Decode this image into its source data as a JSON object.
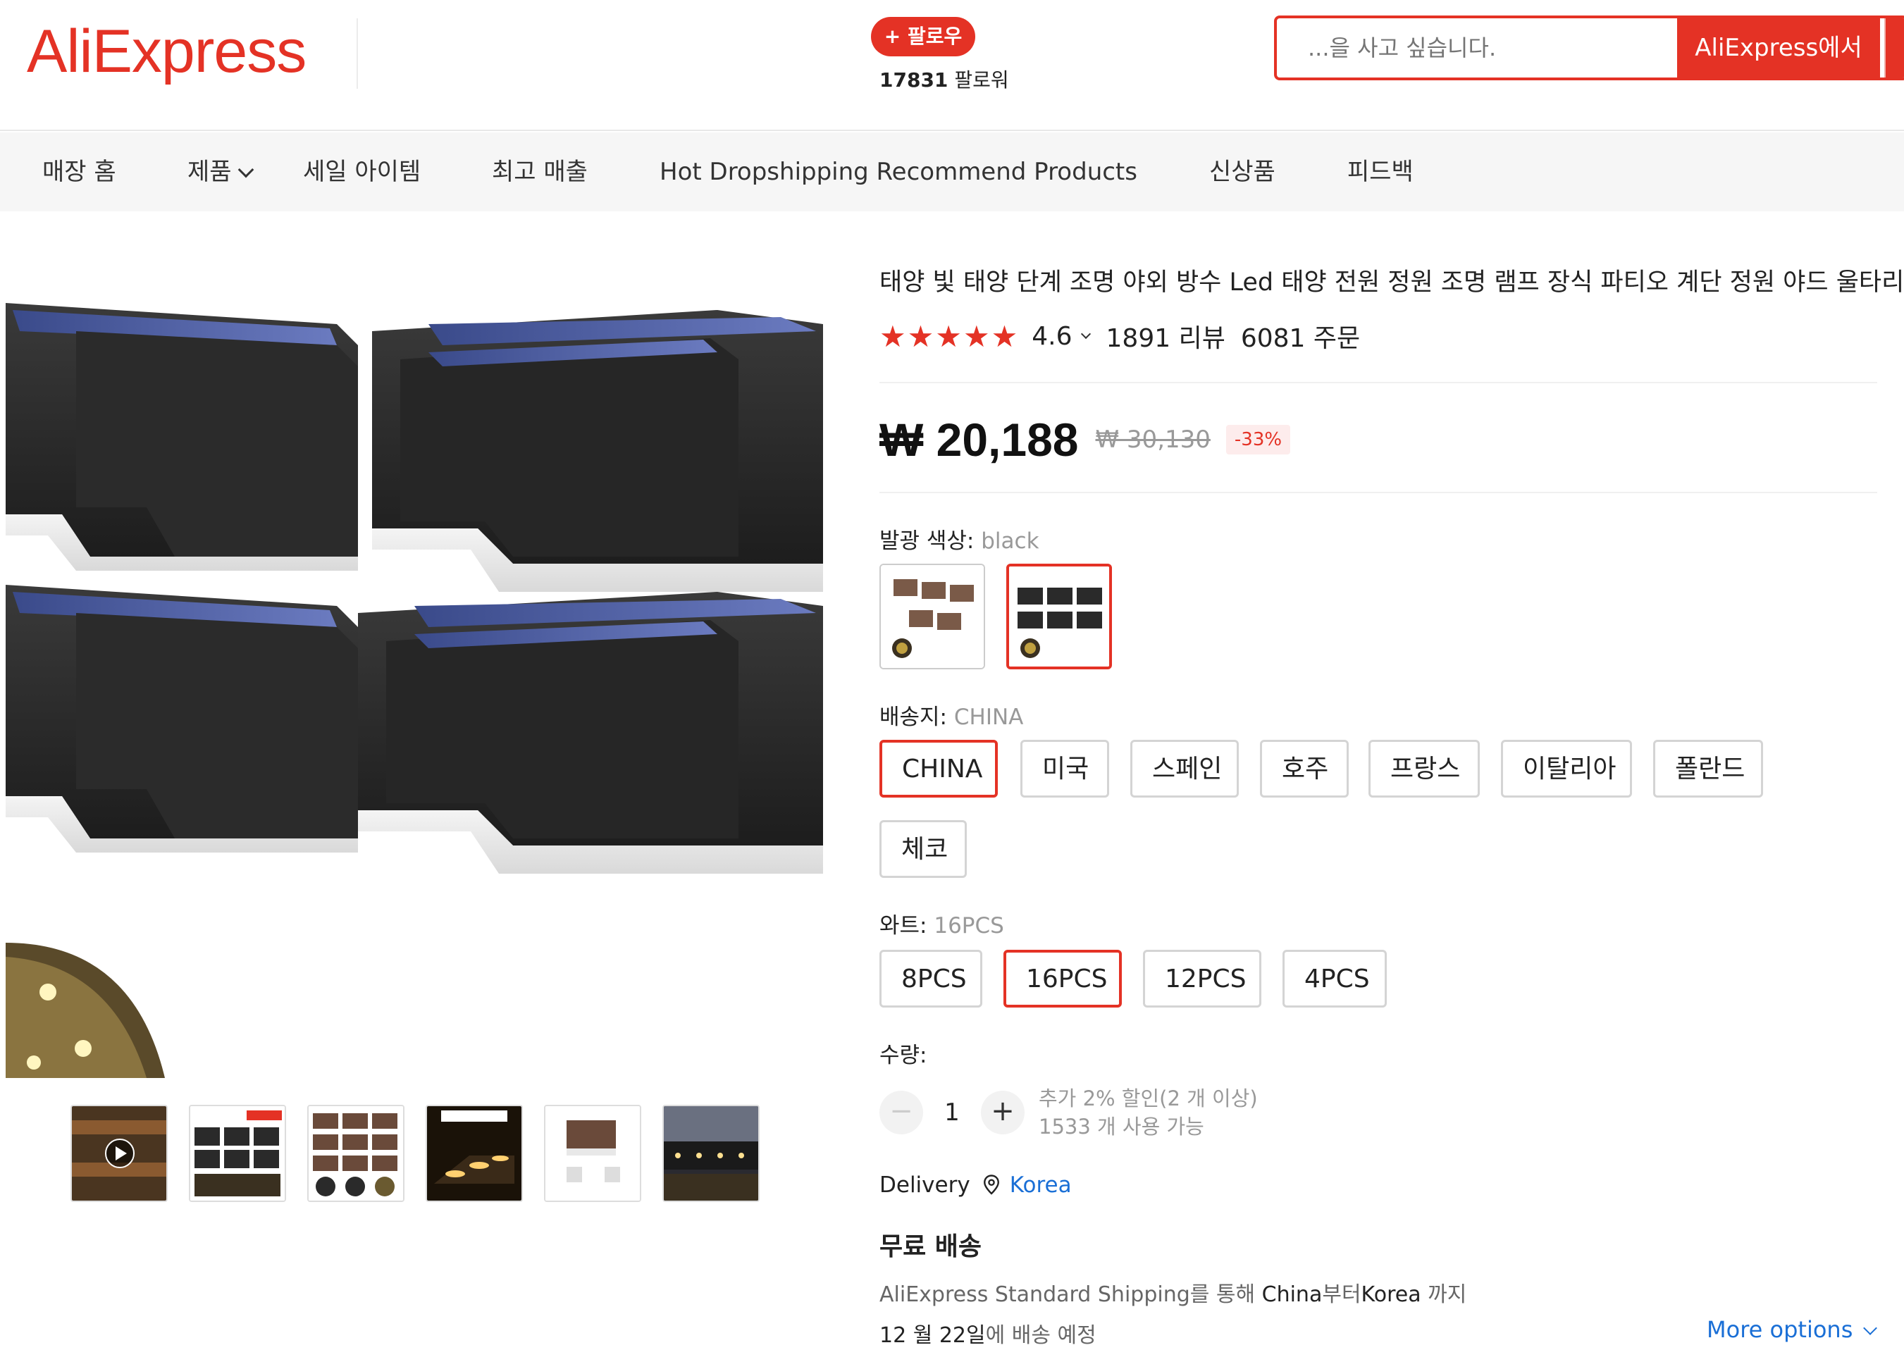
{
  "header": {
    "logo": "AliExpress",
    "follow_label": "+ 팔로우",
    "followers_count": "17831",
    "followers_suffix": " 팔로워",
    "search_placeholder": "...을 사고 싶습니다.",
    "search_button": "AliExpress에서"
  },
  "nav": {
    "items": [
      "매장 홈",
      "제품",
      "세일 아이템",
      "최고 매출",
      "Hot Dropshipping Recommend Products",
      "신상품",
      "피드백"
    ]
  },
  "product": {
    "title": "태양 빛 태양 단계 조명 야외 방수 Led 태양 전원 정원 조명 램프 장식 파티오 계단 정원 야드 울타리",
    "stars": "★★★★★",
    "rating": "4.6",
    "reviews": "1891 리뷰",
    "orders": "6081 주문",
    "price": "₩ 20,188",
    "original_price": "₩ 30,130",
    "discount": "-33%",
    "color_label": "발광 색상: ",
    "color_value": "black",
    "ship_from_label": "배송지: ",
    "ship_from_value": "CHINA",
    "ship_from_options": [
      "CHINA",
      "미국",
      "스페인",
      "호주",
      "프랑스",
      "이탈리아",
      "폴란드",
      "체코"
    ],
    "wattage_label": "와트: ",
    "wattage_value": "16PCS",
    "wattage_options": [
      "8PCS",
      "16PCS",
      "12PCS",
      "4PCS"
    ],
    "quantity_label": "수량:",
    "quantity": "1",
    "qty_minus": "−",
    "qty_plus": "+",
    "discount_note": "추가 2% 할인(2 개 이상)",
    "available_note": "1533 개 사용 가능"
  },
  "shipping": {
    "delivery_label": "Delivery",
    "location": "Korea",
    "free_shipping": "무료 배송",
    "desc_a": "AliExpress Standard Shipping",
    "desc_b": "를 통해 ",
    "desc_c": "China",
    "desc_d": "부터",
    "desc_e": "Korea",
    "desc_f": " 까지",
    "date_a": "12 월 22일",
    "date_b": "에 배송 예정",
    "more_options": "More options"
  },
  "colors": {
    "brand": "#e43225",
    "link": "#1a6fd6"
  }
}
